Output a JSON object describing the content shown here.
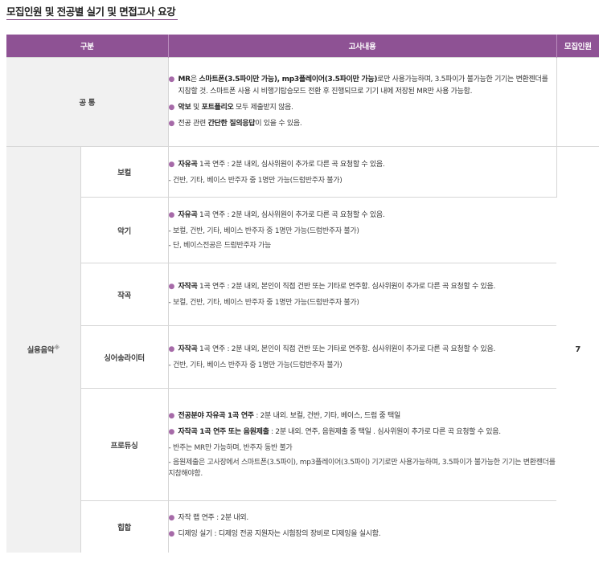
{
  "page": {
    "title": "모집인원 및 전공별 실기 및 면접고사 요강"
  },
  "table": {
    "headers": {
      "category": "구분",
      "content": "고사내용",
      "quota": "모집인원"
    },
    "common": {
      "label": "공 통",
      "items": [
        {
          "parts": [
            "MR",
            "은 ",
            "스마트폰(3.5파이만 가능), mp3플레이어(3.5파이만 가능)",
            "로만 사용가능하며, 3.5파이가 불가능한 기기는 변환젠더를 지참할 것. 스마트폰 사용 시 비행기탑승모드 전환 후 진행되므로 기기 내에 저장된 MR만 사용 가능함."
          ]
        },
        {
          "parts": [
            "악보",
            " 및 ",
            "포트폴리오",
            " 모두 제출받지 않음."
          ]
        },
        {
          "parts": [
            "전공 관련 ",
            "간단한 질의응답",
            "이 있을 수 있음."
          ]
        }
      ]
    },
    "applied_music": {
      "label": "실용음악",
      "mark": "※",
      "quota": "7",
      "vocal": {
        "label": "보컬",
        "b1_bold": "자유곡",
        "b1_text": " 1곡 연주 : 2분 내외, 심사위원이 추가로 다른 곡 요청할 수 있음.",
        "d1": "- 건반, 기타, 베이스 반주자 중 1명만 가능(드럼반주자 불가)"
      },
      "instrument": {
        "label": "악기",
        "b1_bold": "자유곡",
        "b1_text": " 1곡 연주 : 2분 내외, 심사위원이 추가로 다른 곡 요청할 수 있음.",
        "d1": "- 보컬, 건반, 기타, 베이스 반주자 중 1명만 가능(드럼반주자 불가)",
        "d2": "- 단, 베이스전공은 드럼반주자 가능"
      },
      "composition": {
        "label": "작곡",
        "b1_bold": "자작곡",
        "b1_text": " 1곡 연주 : 2분 내외, 본인이 직접 건반 또는 기타로 연주함. 심사위원이 추가로 다른 곡 요청할 수 있음.",
        "d1": "- 보컬, 건반, 기타, 베이스 반주자 중 1명만 가능(드럼반주자 불가)"
      },
      "singer_songwriter": {
        "label": "싱어송라이터",
        "b1_bold": "자작곡",
        "b1_text": " 1곡 연주 : 2분 내외, 본인이 직접 건반 또는 기타로 연주함. 심사위원이 추가로 다른 곡 요청할 수 있음.",
        "d1": "- 건반, 기타, 베이스 반주자 중 1명만 가능(드럼반주자 불가)"
      },
      "producing": {
        "label": "프로듀싱",
        "b1_bold": "전공분야 자유곡 1곡 연주",
        "b1_text": " : 2분 내외. 보컬, 건반, 기타, 베이스, 드럼 중 택일",
        "b2_bold": "자작곡 1곡 연주 또는 음원제출",
        "b2_text": " : 2분 내외. 연주, 음원제출 중 택일 . 심사위원이 추가로 다른 곡 요청할 수 있음.",
        "d1": "- 반주는 MR만 가능하며, 반주자 동반 불가",
        "d2": "- 음원제출은 고사장에서 스마트폰(3.5파이), mp3플레이어(3.5파이) 기기로만 사용가능하며,   3.5파이가 불가능한 기기는 변환젠더를 지참해야함."
      },
      "hiphop": {
        "label": "힙합",
        "b1": "자작 랩 연주 : 2분 내외.",
        "b2": "디제잉 실기 : 디제잉 전공 지원자는 시험장의 장비로 디제잉을 실시함."
      }
    }
  }
}
